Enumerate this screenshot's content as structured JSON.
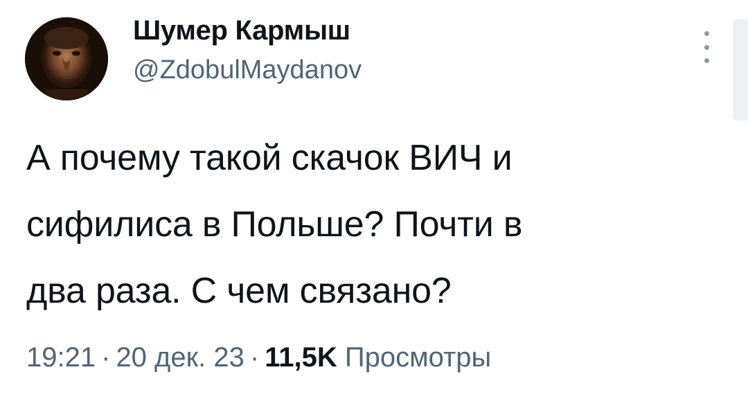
{
  "author": {
    "display_name": "Шумер Кармыш",
    "handle": "@ZdobulMaydanov",
    "avatar_icon": "profile-avatar"
  },
  "tweet": {
    "lines": [
      "А почему такой скачок ВИЧ и",
      "сифилиса в Польше? Почти в",
      "два раза. С чем связано?"
    ]
  },
  "meta": {
    "time": "19:21",
    "separator": "·",
    "date": "20 дек. 23",
    "views_count": "11,5K",
    "views_label": "Просмотры"
  },
  "icons": {
    "more": "more-vertical-icon"
  },
  "colors": {
    "text_primary": "#0f1419",
    "text_secondary": "#536471",
    "background": "#ffffff"
  }
}
